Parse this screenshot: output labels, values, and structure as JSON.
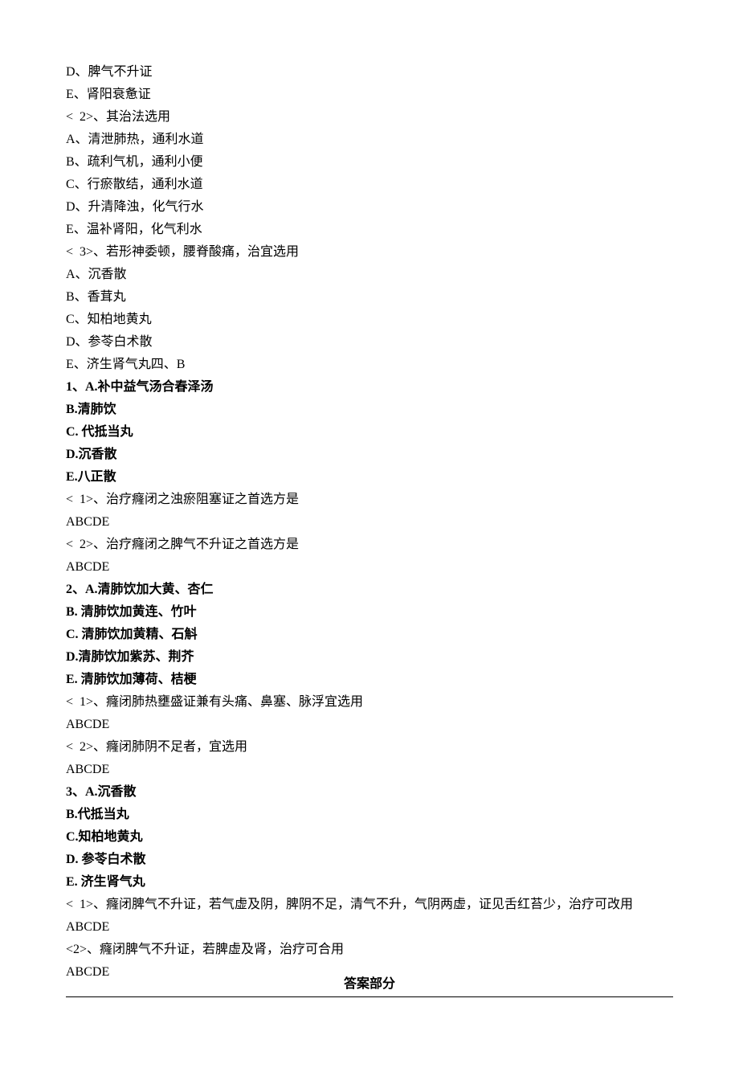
{
  "block1": {
    "lines": [
      "D、脾气不升证",
      "E、肾阳衰惫证",
      "<  2>、其治法选用",
      "A、清泄肺热，通利水道",
      "B、疏利气机，通利小便",
      "C、行瘀散结，通利水道",
      "D、升清降浊，化气行水",
      "E、温补肾阳，化气利水",
      "<  3>、若形神委顿，腰脊酸痛，治宜选用",
      "A、沉香散",
      "B、香茸丸",
      "C、知柏地黄丸",
      "D、参苓白术散",
      "E、济生肾气丸四、B"
    ]
  },
  "q1": {
    "headers": [
      "1、A.补中益气汤合春泽汤",
      "B.清肺饮",
      "C. 代抵当丸",
      "D.沉香散",
      "E.八正散"
    ],
    "subs": [
      "<  1>、治疗癃闭之浊瘀阻塞证之首选方是",
      "ABCDE",
      "<  2>、治疗癃闭之脾气不升证之首选方是",
      "ABCDE"
    ]
  },
  "q2": {
    "headers": [
      "2、A.清肺饮加大黄、杏仁",
      "B. 清肺饮加黄连、竹叶",
      "C. 清肺饮加黄精、石斛",
      "D.清肺饮加紫苏、荆芥",
      "E. 清肺饮加薄荷、桔梗"
    ],
    "subs": [
      "<  1>、癃闭肺热壅盛证兼有头痛、鼻塞、脉浮宜选用",
      "ABCDE",
      "<  2>、癃闭肺阴不足者，宜选用",
      "ABCDE"
    ]
  },
  "q3": {
    "headers": [
      "3、A.沉香散",
      "B.代抵当丸",
      "C.知柏地黄丸",
      "D. 参苓白术散",
      "E. 济生肾气丸"
    ],
    "subs": [
      "<  1>、癃闭脾气不升证，若气虚及阴，脾阴不足，清气不升，气阴两虚，证见舌红苔少，治疗可改用 ABCDE",
      "<2>、癃闭脾气不升证，若脾虚及肾，治疗可合用",
      "ABCDE"
    ]
  },
  "answer_title": "答案部分"
}
